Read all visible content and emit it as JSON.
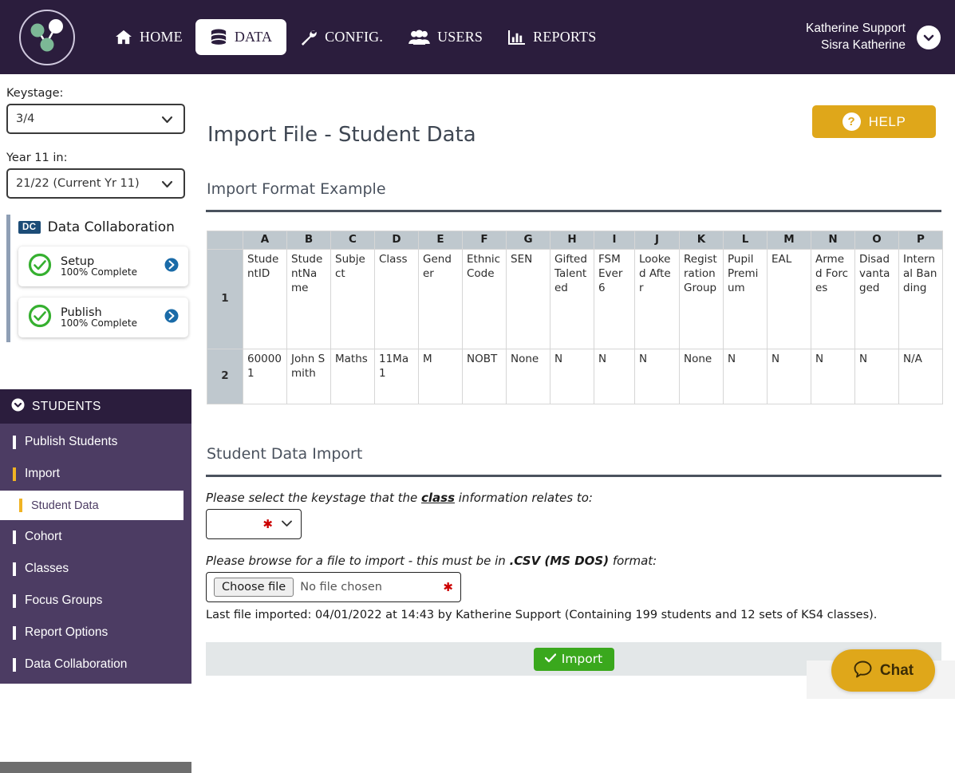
{
  "topnav": {
    "logo_icon": "network-nodes-logo",
    "items": [
      {
        "label": "HOME",
        "icon": "home-icon",
        "active": false
      },
      {
        "label": "DATA",
        "icon": "database-icon",
        "active": true
      },
      {
        "label": "CONFIG.",
        "icon": "wrench-icon",
        "active": false
      },
      {
        "label": "USERS",
        "icon": "users-icon",
        "active": false
      },
      {
        "label": "REPORTS",
        "icon": "bar-chart-icon",
        "active": false
      }
    ],
    "user": {
      "name": "Katherine Support",
      "org": "Sisra Katherine",
      "caret_icon": "chevron-down-icon"
    }
  },
  "sidebar": {
    "keystage_label": "Keystage:",
    "keystage_value": "3/4",
    "year_label": "Year 11 in:",
    "year_value": "21/22 (Current Yr 11)",
    "dc": {
      "badge": "DC",
      "title": "Data Collaboration",
      "cards": [
        {
          "name": "Setup",
          "status": "100% Complete",
          "check_icon": "check-circle-icon",
          "arrow_icon": "arrow-right-circle-icon"
        },
        {
          "name": "Publish",
          "status": "100% Complete",
          "check_icon": "check-circle-icon",
          "arrow_icon": "arrow-right-circle-icon"
        }
      ]
    },
    "menu_header": "STUDENTS",
    "menu_header_icon": "chevron-down-circle-icon",
    "items": [
      {
        "label": "Publish Students",
        "selected": false,
        "sub": false,
        "accent": "white"
      },
      {
        "label": "Import",
        "selected": false,
        "sub": false,
        "accent": "amber"
      },
      {
        "label": "Student Data",
        "selected": true,
        "sub": true,
        "accent": "amber"
      },
      {
        "label": "Cohort",
        "selected": false,
        "sub": false,
        "accent": "white"
      },
      {
        "label": "Classes",
        "selected": false,
        "sub": false,
        "accent": "white"
      },
      {
        "label": "Focus Groups",
        "selected": false,
        "sub": false,
        "accent": "white"
      },
      {
        "label": "Report Options",
        "selected": false,
        "sub": false,
        "accent": "white"
      },
      {
        "label": "Data Collaboration",
        "selected": false,
        "sub": false,
        "accent": "white"
      }
    ]
  },
  "main": {
    "page_title": "Import File - Student Data",
    "help_button": {
      "label": "HELP",
      "icon": "question-mark-icon"
    },
    "format_section_title": "Import Format Example",
    "import_section_title": "Student Data Import",
    "table": {
      "column_letters": [
        "A",
        "B",
        "C",
        "D",
        "E",
        "F",
        "G",
        "H",
        "I",
        "J",
        "K",
        "L",
        "M",
        "N",
        "O",
        "P"
      ],
      "rows": [
        {
          "number": "1",
          "cells": [
            "StudentID",
            "StudentName",
            "Subject",
            "Class",
            "Gender",
            "Ethnic Code",
            "SEN",
            "Gifted Talented",
            "FSM Ever 6",
            "Looked After",
            "Registration Group",
            "Pupil Premium",
            "EAL",
            "Armed Forces",
            "Disadvantaged",
            "Internal Banding"
          ]
        },
        {
          "number": "2",
          "cells": [
            "600001",
            "John Smith",
            "Maths",
            "11Ma1",
            "M",
            "NOBT",
            "None",
            "N",
            "N",
            "N",
            "None",
            "N",
            "N",
            "N",
            "N",
            "N/A"
          ]
        }
      ]
    },
    "form": {
      "keystage_prompt_pre": "Please select the keystage that the ",
      "keystage_prompt_em": "class",
      "keystage_prompt_post": " information relates to:",
      "keystage_select_value": "",
      "keystage_required_marker": "✱",
      "file_prompt_pre": "Please browse for a file to import - this must be in ",
      "file_prompt_bold": ".CSV (MS DOS)",
      "file_prompt_post": " format:",
      "choose_file_label": "Choose file",
      "file_chosen_text": "No file chosen",
      "file_required_marker": "✱",
      "last_import": "Last file imported: 04/01/2022 at 14:43 by Katherine Support (Containing 199 students and 12 sets of KS4 classes).",
      "import_button": {
        "label": "Import",
        "icon": "check-icon"
      }
    }
  },
  "chat": {
    "label": "Chat",
    "icon": "speech-bubble-icon"
  },
  "colors": {
    "nav_purple": "#2b1d3d",
    "menu_purple": "#4c3c63",
    "amber": "#dfa71a",
    "green": "#3aa81d",
    "table_header": "#bfc8ce",
    "accent_amber": "#f0b323"
  }
}
